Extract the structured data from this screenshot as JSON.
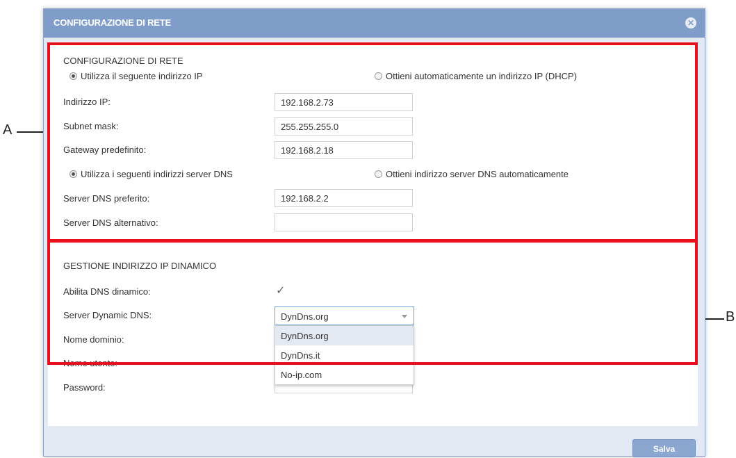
{
  "dialog": {
    "title": "CONFIGURAZIONE DI RETE",
    "close_icon": "close-icon"
  },
  "network": {
    "heading": "CONFIGURAZIONE DI RETE",
    "radio_static_ip": {
      "label": "Utilizza il seguente indirizzo IP",
      "checked": true
    },
    "radio_dhcp": {
      "label": "Ottieni automaticamente un indirizzo IP (DHCP)",
      "checked": false
    },
    "ip_label": "Indirizzo IP:",
    "ip_value": "192.168.2.73",
    "subnet_label": "Subnet mask:",
    "subnet_value": "255.255.255.0",
    "gateway_label": "Gateway predefinito:",
    "gateway_value": "192.168.2.18",
    "radio_static_dns": {
      "label": "Utilizza i seguenti indirizzi server DNS",
      "checked": true
    },
    "radio_auto_dns": {
      "label": "Ottieni indirizzo server DNS automaticamente",
      "checked": false
    },
    "dns_pref_label": "Server DNS preferito:",
    "dns_pref_value": "192.168.2.2",
    "dns_alt_label": "Server DNS alternativo:",
    "dns_alt_value": ""
  },
  "ddns": {
    "heading": "GESTIONE INDIRIZZO IP DINAMICO",
    "enable_label": "Abilita DNS dinamico:",
    "enable_checked": true,
    "server_label": "Server Dynamic DNS:",
    "server_value": "DynDns.org",
    "options": [
      "DynDns.org",
      "DynDns.it",
      "No-ip.com"
    ],
    "domain_label": "Nome dominio:",
    "user_label": "Nome utente:",
    "password_label": "Password:"
  },
  "footer": {
    "save_label": "Salva"
  },
  "annotations": {
    "a": "A",
    "b": "B"
  },
  "colors": {
    "title_bar": "#7f9dc8",
    "highlight_box": "#e8101b",
    "button": "#8ba6cf"
  }
}
